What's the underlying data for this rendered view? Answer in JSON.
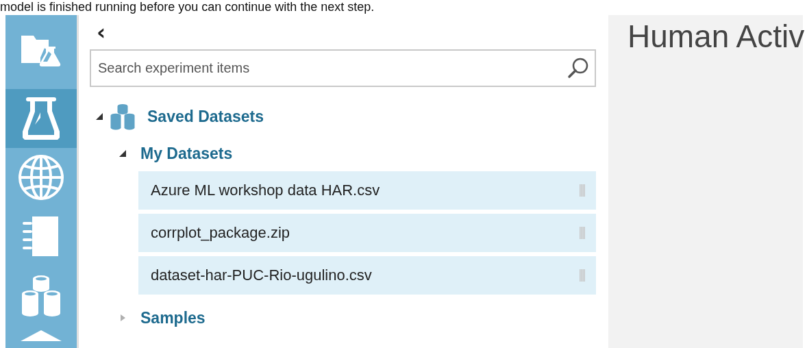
{
  "caption": "model is finished running before you can continue with the next step.",
  "sidebar": {
    "items": [
      {
        "kind": "projects",
        "selected": false
      },
      {
        "kind": "experiments",
        "selected": true
      },
      {
        "kind": "web-services",
        "selected": false
      },
      {
        "kind": "notebooks",
        "selected": false
      },
      {
        "kind": "datasets",
        "selected": false
      },
      {
        "kind": "more",
        "selected": false
      }
    ]
  },
  "back_button": "‹",
  "search": {
    "placeholder": "Search experiment items"
  },
  "tree": [
    {
      "label": "Saved Datasets",
      "expanded": true,
      "children": [
        {
          "label": "My Datasets",
          "expanded": true,
          "children": [
            {
              "label": "Azure ML workshop data HAR.csv"
            },
            {
              "label": "corrplot_package.zip"
            },
            {
              "label": "dataset-har-PUC-Rio-ugulino.csv"
            }
          ]
        },
        {
          "label": "Samples",
          "expanded": false
        }
      ]
    }
  ],
  "canvas": {
    "title": "Human Activ"
  }
}
